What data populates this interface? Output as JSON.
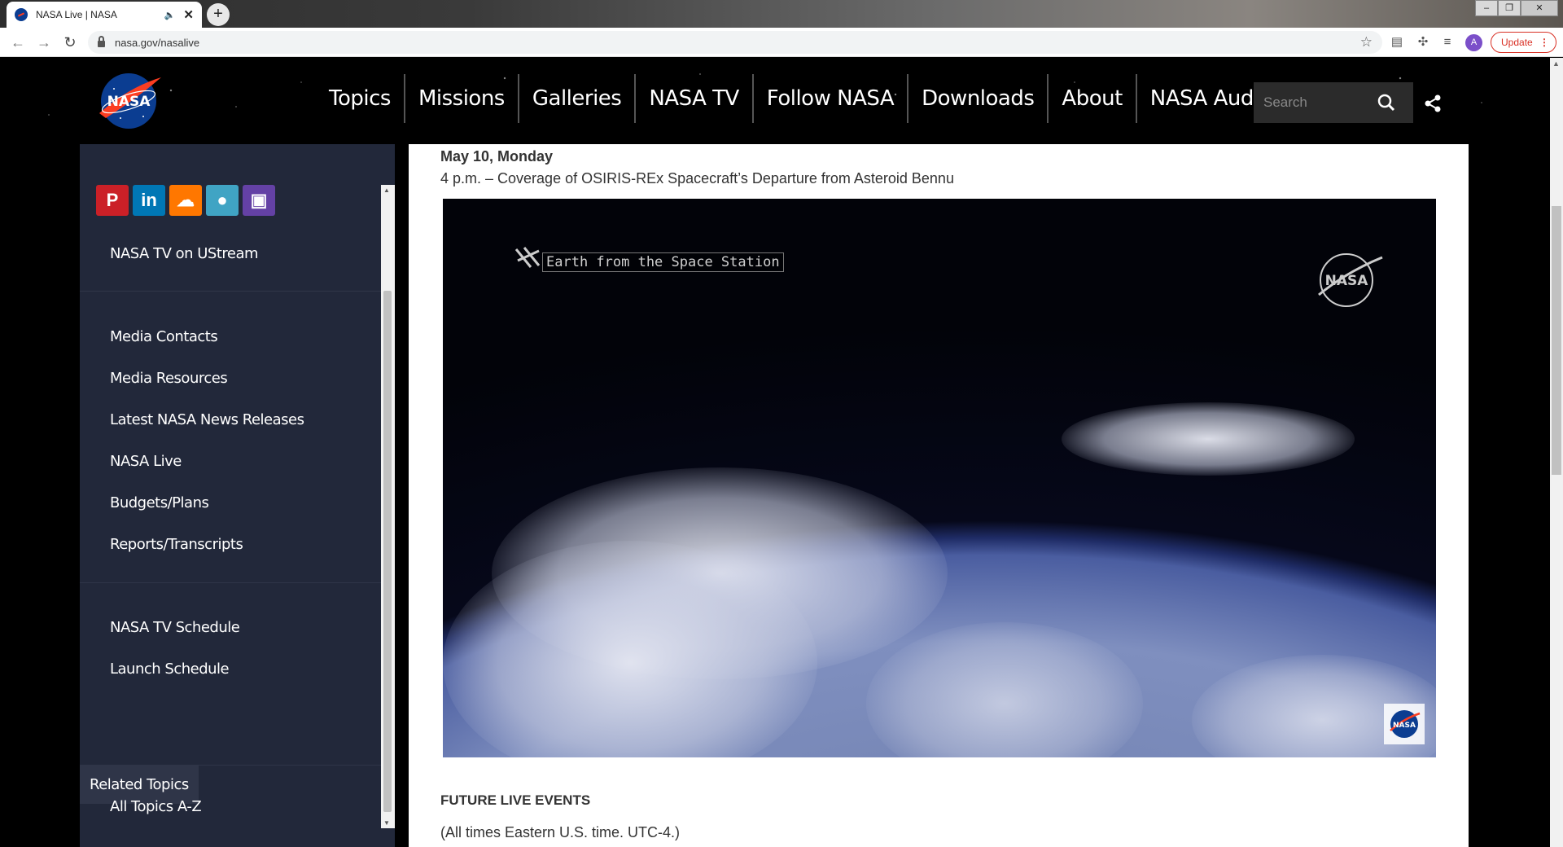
{
  "browser": {
    "tab_title": "NASA Live | NASA",
    "new_tab": "+",
    "url": "nasa.gov/nasalive",
    "profile_initial": "A",
    "update_label": "Update",
    "window_controls": [
      "–",
      "❐",
      "✕"
    ]
  },
  "header": {
    "logo_text": "NASA",
    "nav": [
      "Topics",
      "Missions",
      "Galleries",
      "NASA TV",
      "Follow NASA",
      "Downloads",
      "About",
      "NASA Audiences"
    ],
    "search_placeholder": "Search"
  },
  "sidebar": {
    "social": [
      {
        "icon": "pinterest-icon",
        "glyph": "P",
        "color": "#cb2027"
      },
      {
        "icon": "linkedin-icon",
        "glyph": "in",
        "color": "#0077b5"
      },
      {
        "icon": "soundcloud-icon",
        "glyph": "☁",
        "color": "#ff7700"
      },
      {
        "icon": "periscope-icon",
        "glyph": "●",
        "color": "#40a4c4"
      },
      {
        "icon": "twitch-icon",
        "glyph": "▣",
        "color": "#6441a5"
      }
    ],
    "ustream": "NASA TV on UStream",
    "group1": [
      "Media Contacts",
      "Media Resources",
      "Latest NASA News Releases",
      "NASA Live",
      "Budgets/Plans",
      "Reports/Transcripts"
    ],
    "group2": [
      "NASA TV Schedule",
      "Launch Schedule"
    ],
    "related_header": "Related Topics",
    "related_link": "All Topics A-Z"
  },
  "content": {
    "date_heading": "May 10, Monday",
    "event": "4 p.m. – Coverage of OSIRIS-REx Spacecraft’s Departure from Asteroid Bennu",
    "video_caption": "Earth from the Space Station",
    "video_logo": "NASA",
    "future_heading": "FUTURE LIVE EVENTS",
    "future_note": "(All times Eastern U.S. time. UTC-4.)"
  }
}
